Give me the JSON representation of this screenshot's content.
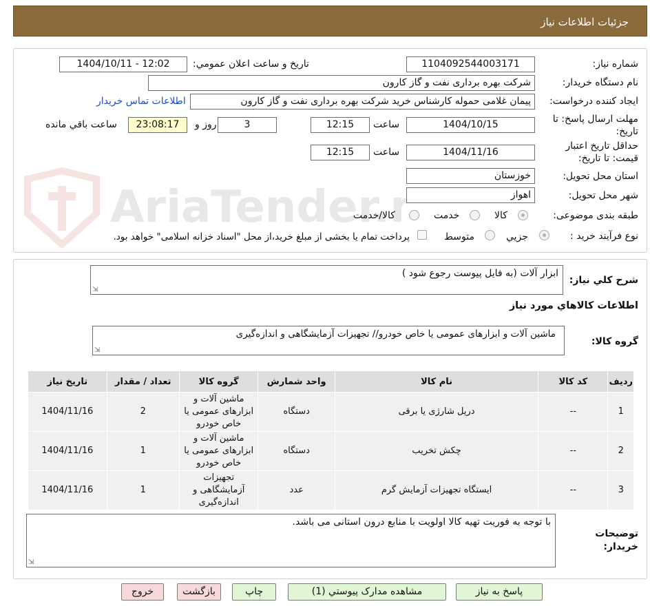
{
  "header": {
    "title": "جزئیات اطلاعات نیاز"
  },
  "form": {
    "need_number_label": "شماره نیاز:",
    "need_number": "1104092544003171",
    "announce_label": "تاریخ و ساعت اعلان عمومي:",
    "announce_value": "1404/10/11 - 12:02",
    "buyer_org_label": "نام دستگاه خريدار:",
    "buyer_org": "شرکت بهره برداری نفت و گاز کارون",
    "requester_label": "ايجاد کننده درخواست:",
    "requester": "پیمان غلامی حموله کارشناس خرید شرکت بهره برداری نفت و گاز کارون",
    "buyer_contact_link": "اطلاعات تماس خریدار",
    "deadline_label_1": "مهلت ارسال پاسخ: تا",
    "deadline_label_2": "تاریخ:",
    "deadline_date": "1404/10/15",
    "time_label": "ساعت",
    "deadline_time": "12:15",
    "days_value": "3",
    "days_label": "روز و",
    "remaining_value": "23:08:17",
    "remaining_label": "ساعت باقي مانده",
    "validity_label_1": "حداقل تاريخ اعتبار",
    "validity_label_2": "قيمت: تا تاريخ:",
    "validity_date": "1404/11/16",
    "validity_time": "12:15",
    "province_label": "استان محل تحويل:",
    "province": "خوزستان",
    "city_label": "شهر محل تحويل:",
    "city": "اهواز",
    "category_label": "طبقه بندی موضوعی:",
    "category_options": [
      "کالا",
      "خدمت",
      "کالا/خدمت"
    ],
    "process_label": "نوع فرآیند خرید :",
    "process_options": [
      "جزيي",
      "متوسط"
    ],
    "payment_note": "پرداخت تمام یا بخشی از مبلغ خرید،از محل \"اسناد خزانه اسلامی\" خواهد بود."
  },
  "watermark": {
    "text": "AriaTender.neT"
  },
  "summary": {
    "label": "شرح کلي نياز:",
    "value": "ابزار آلات (به فایل پیوست رجوع شود )",
    "goods_info_title": "اطلاعات کالاهاي مورد نياز",
    "group_label": "گروه کالا:",
    "group_value": "ماشین آلات و ابزارهای عمومی یا خاص خودرو// تجهیزات آزمایشگاهی و اندازه‌گیری"
  },
  "table": {
    "headers": [
      "ردیف",
      "کد کالا",
      "نام کالا",
      "واحد شمارش",
      "گروه کالا",
      "تعداد / مقدار",
      "تاریخ نیاز"
    ],
    "rows": [
      [
        "1",
        "--",
        "دریل شارژی یا برقی",
        "دستگاه",
        "ماشین آلات و ابزارهای عمومی یا خاص خودرو",
        "2",
        "1404/11/16"
      ],
      [
        "2",
        "--",
        "چکش تخریب",
        "دستگاه",
        "ماشین آلات و ابزارهای عمومی یا خاص خودرو",
        "1",
        "1404/11/16"
      ],
      [
        "3",
        "--",
        "ایستگاه تجهیزات آزمایش گرم",
        "عدد",
        "تجهیزات آزمایشگاهی و اندازه‌گیری",
        "1",
        "1404/11/16"
      ]
    ]
  },
  "notes": {
    "label_1": "توضیحات",
    "label_2": "خریدار:",
    "value": "با توجه به فوریت تهیه کالا اولویت با منابع درون استانی می باشد."
  },
  "buttons": {
    "reply": "پاسخ به نیاز",
    "docs": "مشاهده مدارک پیوستي (1)",
    "print": "چاپ",
    "back": "بازگشت",
    "exit": "خروج"
  },
  "colors": {
    "header_bg": "#8b6a3c",
    "link": "#1a4dc8",
    "green_button": "#e2f5d4",
    "pink_button": "#f7d9da",
    "remaining_bg": "#ffffcc"
  }
}
